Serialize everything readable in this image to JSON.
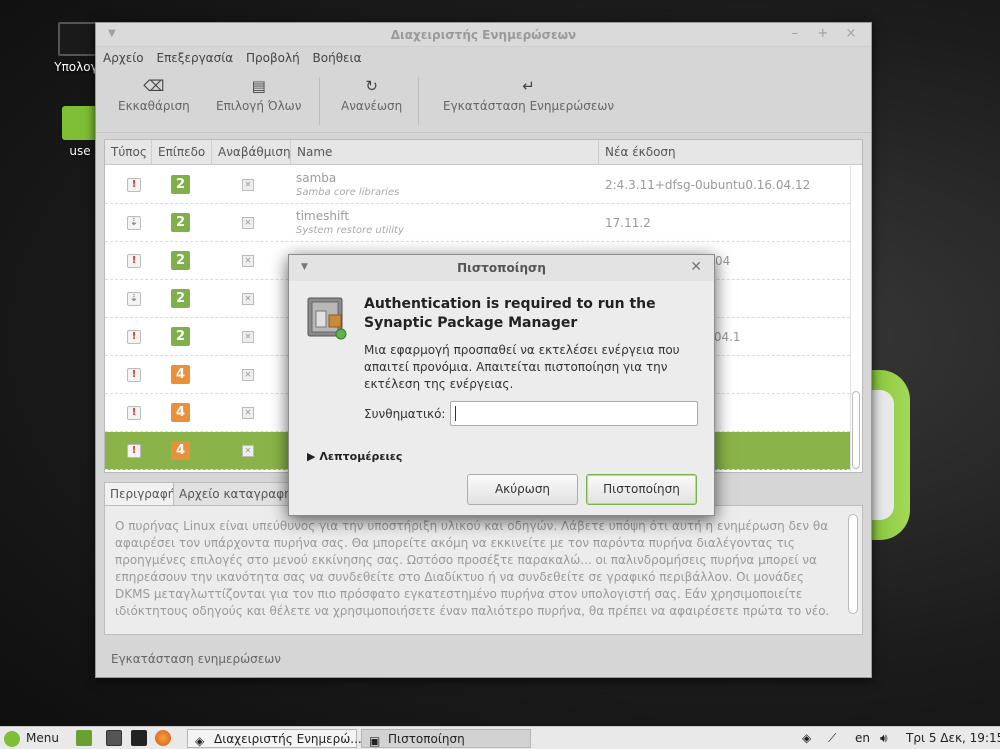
{
  "desktop": {
    "icons": [
      {
        "label": "Υπολογι"
      },
      {
        "label": "use"
      }
    ]
  },
  "window": {
    "title": "Διαχειριστής Ενημερώ­σεων",
    "controls": [
      "–",
      "+",
      "×"
    ]
  },
  "menu": [
    "Αρχείο",
    "Επεξεργασία",
    "Προβολή",
    "Βοήθεια"
  ],
  "toolbar": {
    "clear": "Εκκαθάριση",
    "select_all": "Επιλογή Όλων",
    "refresh": "Ανανέωση",
    "install": "Εγκατάσταση Ενημερώσεων"
  },
  "table": {
    "headers": [
      "Τύπος",
      "Επίπεδο",
      "Αναβάθμιση",
      "Name",
      "Νέα έκδοση"
    ],
    "rows": [
      {
        "type": "security",
        "level": "2",
        "name": "samba",
        "desc": "Samba core libraries",
        "version": "2:4.3.11+dfsg-0ubuntu0.16.04.12"
      },
      {
        "type": "package",
        "level": "2",
        "name": "timeshift",
        "desc": "System restore utility",
        "version": "17.11.2"
      },
      {
        "type": "security",
        "level": "2",
        "name": "",
        "desc": "",
        "version": "04"
      },
      {
        "type": "package",
        "level": "2",
        "name": "",
        "desc": "",
        "version": ""
      },
      {
        "type": "security",
        "level": "2",
        "name": "",
        "desc": "",
        "version": ".04.1"
      },
      {
        "type": "security",
        "level": "4",
        "name": "",
        "desc": "",
        "version": ""
      },
      {
        "type": "security",
        "level": "4",
        "name": "",
        "desc": "",
        "version": ""
      },
      {
        "type": "security",
        "level": "4",
        "name": "",
        "desc": "",
        "version": ""
      }
    ]
  },
  "tabs": [
    "Περιγραφή",
    "Αρχείο καταγραφής"
  ],
  "description": "Ο πυρήνας Linux είναι υπεύθυνος για την υποστήριξη υλικού και οδηγών. Λάβετε υπόψη ότι αυτή η ενημέρωση δεν θα αφαιρέσει τον υπάρχοντα πυρήνα σας. Θα μπορείτε ακόμη να εκκινείτε με τον παρόντα πυρήνα διαλέγοντας τις προηγμένες επιλογές στο μενού εκκίνησης σας. Ωστόσο προσέξτε παρακαλώ... οι παλινδρομήσεις πυρήνα μπορεί να επηρεάσουν την ικανότητα σας να συνδεθείτε στο Διαδίκτυο ή να συνδεθείτε σε γραφικό περιβάλλον. Οι μονάδες DKMS μεταγλωττίζονται για τον πιο πρόσφατο εγκατεστημένο πυρήνα στον υπολογιστή σας. Εάν χρησιμοποιείτε ιδιόκτητους οδηγούς και θέλετε να χρησιμοποιήσετε έναν παλιότερο πυρήνα, θα πρέπει να αφαιρέσετε πρώτα το νέο.",
  "status": "Εγκατάσταση ενημερώσεων",
  "dialog": {
    "title": "Πιστοποίηση",
    "heading": "Authentication is required to run the Synaptic Package Manager",
    "message": "Μια εφαρμογή προσπαθεί να εκτελέσει ενέργεια που απαιτεί προνόμια. Απαιτείται πιστοποίηση για την εκτέλεση της ενέργειας.",
    "password_label": "Συνθηματικό:",
    "password_value": "",
    "details": "Λεπτομέρειες",
    "cancel": "Ακύρωση",
    "ok": "Πιστοποίηση"
  },
  "taskbar": {
    "menu": "Menu",
    "task1": "Διαχειριστής Ενημερώ...",
    "task2": "Πιστοποίηση",
    "lang": "en",
    "clock": "Τρι 5 Δεκ, 19:15"
  },
  "colors": {
    "accent": "#8ab449",
    "level2": "#7fb04a",
    "level4": "#e8913a"
  }
}
